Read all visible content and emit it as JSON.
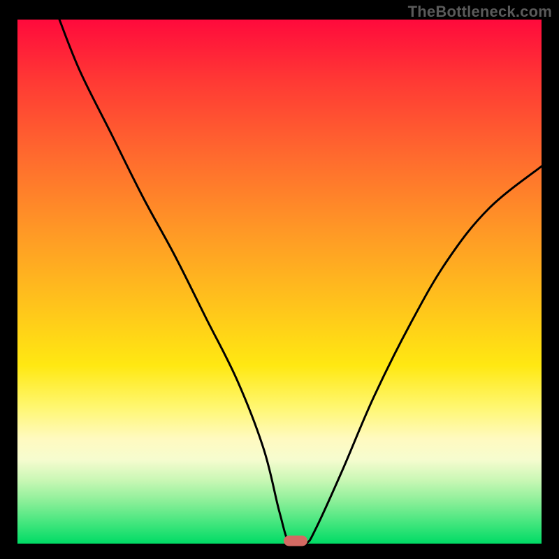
{
  "watermark": "TheBottleneck.com",
  "chart_data": {
    "type": "line",
    "title": "",
    "xlabel": "",
    "ylabel": "",
    "xlim": [
      0,
      100
    ],
    "ylim": [
      0,
      100
    ],
    "grid": false,
    "legend": false,
    "background": "rainbow-vertical-gradient (red top → green bottom)",
    "series": [
      {
        "name": "bottleneck-curve",
        "x": [
          8,
          12,
          18,
          24,
          30,
          36,
          42,
          47,
          50,
          52,
          55,
          57,
          62,
          68,
          75,
          82,
          90,
          100
        ],
        "y": [
          100,
          90,
          78,
          66,
          55,
          43,
          31,
          18,
          6,
          0,
          0,
          3,
          14,
          28,
          42,
          54,
          64,
          72
        ]
      }
    ],
    "marker": {
      "x": 53,
      "y": 0,
      "shape": "rounded-rect",
      "color": "#d46a63"
    },
    "gradient_stops": [
      {
        "pct": 0,
        "color": "#ff0a3c"
      },
      {
        "pct": 12,
        "color": "#ff3a34"
      },
      {
        "pct": 26,
        "color": "#ff6a2e"
      },
      {
        "pct": 40,
        "color": "#ff9726"
      },
      {
        "pct": 54,
        "color": "#ffc21c"
      },
      {
        "pct": 66,
        "color": "#ffe812"
      },
      {
        "pct": 74,
        "color": "#fff771"
      },
      {
        "pct": 80,
        "color": "#fffac0"
      },
      {
        "pct": 84,
        "color": "#f6fccf"
      },
      {
        "pct": 88,
        "color": "#c8f7b4"
      },
      {
        "pct": 92,
        "color": "#8aef98"
      },
      {
        "pct": 96,
        "color": "#44e67e"
      },
      {
        "pct": 100,
        "color": "#00db65"
      }
    ]
  }
}
